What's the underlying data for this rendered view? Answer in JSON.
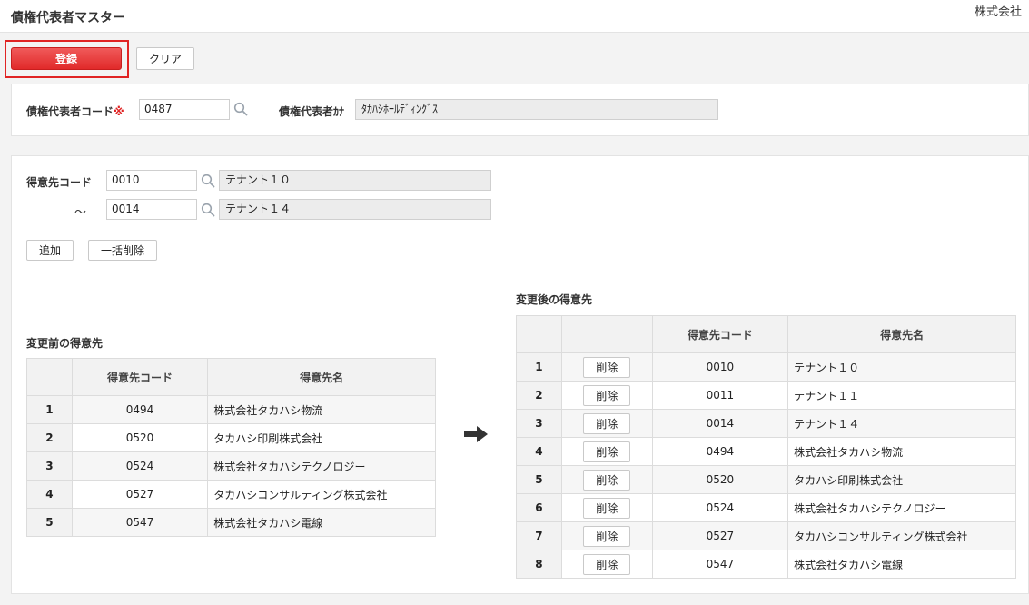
{
  "header": {
    "title": "債権代表者マスター",
    "company": "株式会社"
  },
  "toolbar": {
    "register_label": "登録",
    "clear_label": "クリア"
  },
  "representative": {
    "code_label": "債権代表者コード",
    "required_mark": "※",
    "code_value": "0487",
    "kana_label": "債権代表者ｶﾅ",
    "kana_value": "ﾀｶﾊｼﾎｰﾙﾃﾞｨﾝｸﾞｽ"
  },
  "range": {
    "label": "得意先コード",
    "tilde": "～",
    "from_code": "0010",
    "from_name": "テナント１０",
    "to_code": "0014",
    "to_name": "テナント１４"
  },
  "actions": {
    "add_label": "追加",
    "bulk_delete_label": "一括削除"
  },
  "before": {
    "title": "変更前の得意先",
    "columns": [
      "得意先コード",
      "得意先名"
    ],
    "rows": [
      {
        "no": "1",
        "code": "0494",
        "name": "株式会社タカハシ物流"
      },
      {
        "no": "2",
        "code": "0520",
        "name": "タカハシ印刷株式会社"
      },
      {
        "no": "3",
        "code": "0524",
        "name": "株式会社タカハシテクノロジー"
      },
      {
        "no": "4",
        "code": "0527",
        "name": "タカハシコンサルティング株式会社"
      },
      {
        "no": "5",
        "code": "0547",
        "name": "株式会社タカハシ電線"
      }
    ]
  },
  "after": {
    "title": "変更後の得意先",
    "columns": [
      "得意先コード",
      "得意先名"
    ],
    "delete_label": "削除",
    "rows": [
      {
        "no": "1",
        "code": "0010",
        "name": "テナント１０"
      },
      {
        "no": "2",
        "code": "0011",
        "name": "テナント１１"
      },
      {
        "no": "3",
        "code": "0014",
        "name": "テナント１４"
      },
      {
        "no": "4",
        "code": "0494",
        "name": "株式会社タカハシ物流"
      },
      {
        "no": "5",
        "code": "0520",
        "name": "タカハシ印刷株式会社"
      },
      {
        "no": "6",
        "code": "0524",
        "name": "株式会社タカハシテクノロジー"
      },
      {
        "no": "7",
        "code": "0527",
        "name": "タカハシコンサルティング株式会社"
      },
      {
        "no": "8",
        "code": "0547",
        "name": "株式会社タカハシ電線"
      }
    ]
  },
  "icons": {
    "search": "search-icon",
    "transfer": "arrow-right-icon"
  },
  "colors": {
    "accent": "#e12a2a",
    "header_bg": "#f2f2f2",
    "panel_border": "#e3e3e3"
  }
}
